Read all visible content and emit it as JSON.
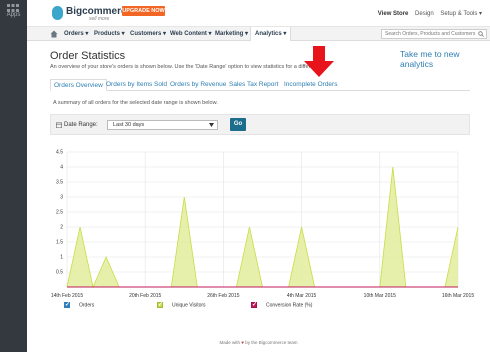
{
  "sidebar": {
    "apps_label": "Apps"
  },
  "header": {
    "logo_text": "Bigcommerce",
    "logo_tagline": "sell more",
    "upgrade_label": "UPGRADE NOW",
    "view_store": "View Store",
    "design": "Design",
    "setup_tools": "Setup & Tools ▾"
  },
  "nav": {
    "items": [
      "Orders ▾",
      "Products ▾",
      "Customers ▾",
      "Web Content ▾",
      "Marketing ▾",
      "Analytics ▾"
    ],
    "search_placeholder": "Search Orders, Products and Customers"
  },
  "page": {
    "title": "Order Statistics",
    "new_analytics_link": "Take me to new analytics",
    "subtitle": "An overview of your store's orders is shown below. Use the 'Date Range' option to view statistics for a different period.",
    "summary": "A summary of all orders for the selected date range is shown below."
  },
  "tabs": [
    "Orders Overview",
    "Orders by Items Sold",
    "Orders by Revenue",
    "Sales Tax Report",
    "Incomplete Orders"
  ],
  "active_tab": "Orders Overview",
  "date_range": {
    "label": "Date Range:",
    "selected": "Last 30 days",
    "go_label": "Go"
  },
  "chart_data": {
    "type": "area",
    "x_tick_labels": [
      "14th Feb 2015",
      "20th Feb 2015",
      "26th Feb 2015",
      "4th Mar 2015",
      "10th Mar 2015",
      "16th Mar 2015"
    ],
    "x_day_index": [
      0,
      6,
      12,
      18,
      24,
      30
    ],
    "yticks": [
      "0.5",
      "1",
      "1.5",
      "2",
      "2.5",
      "3",
      "3.5",
      "4",
      "4.5"
    ],
    "ylim": [
      0,
      4.5
    ],
    "grid": true,
    "series": [
      {
        "name": "Orders",
        "color": "#2f7fbf",
        "values": [
          0,
          0,
          0,
          0,
          0,
          0,
          0,
          0,
          0,
          0,
          0,
          0,
          0,
          0,
          0,
          0,
          0,
          0,
          0,
          0,
          0,
          0,
          0,
          0,
          0,
          0,
          0,
          0,
          0,
          0,
          0
        ]
      },
      {
        "name": "Unique Visitors",
        "color": "#c9dc46",
        "values": [
          0,
          2,
          0,
          1,
          0,
          0,
          0,
          0,
          0,
          3,
          0,
          0,
          0,
          0,
          2,
          0,
          0,
          0,
          2,
          0,
          0,
          0,
          0,
          0,
          0,
          4,
          0,
          0,
          0,
          0,
          2
        ]
      },
      {
        "name": "Conversion Rate (%)",
        "color": "#c2185b",
        "values": [
          0,
          0,
          0,
          0,
          0,
          0,
          0,
          0,
          0,
          0,
          0,
          0,
          0,
          0,
          0,
          0,
          0,
          0,
          0,
          0,
          0,
          0,
          0,
          0,
          0,
          0,
          0,
          0,
          0,
          0,
          0
        ]
      }
    ]
  },
  "legend": [
    "Orders",
    "Unique Visitors",
    "Conversion Rate (%)"
  ],
  "footer": {
    "prefix": "Made with",
    "heart": "♥",
    "suffix": "by the Bigcommerce team"
  },
  "colors": {
    "accent": "#2e7fb4",
    "upgrade": "#f26522",
    "go_button": "#1c6e8c",
    "sidebar": "#34393f"
  }
}
